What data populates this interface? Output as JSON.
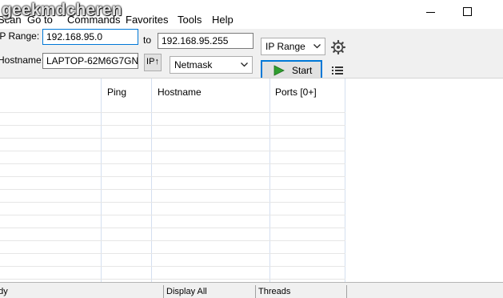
{
  "watermark": "geekmdcheren",
  "menu": {
    "scan": "Scan",
    "go_to": "Go to",
    "commands": "Commands",
    "favorites": "Favorites",
    "tools": "Tools",
    "help": "Help"
  },
  "toolbar": {
    "ip_range_label": "IP Range:",
    "range_start": "192.168.95.0",
    "to_label": "to",
    "range_end": "192.168.95.255",
    "range_type": "IP Range",
    "hostname_label": "Hostname:",
    "hostname_value": "LAPTOP-62M6G7GN",
    "ip_button": "IP↑",
    "netmask": "Netmask",
    "start_label": "Start"
  },
  "table": {
    "columns": [
      "",
      "Ping",
      "Hostname",
      "Ports [0+]"
    ]
  },
  "statusbar": {
    "left": "Ready",
    "display": "Display All",
    "threads": "Threads"
  }
}
